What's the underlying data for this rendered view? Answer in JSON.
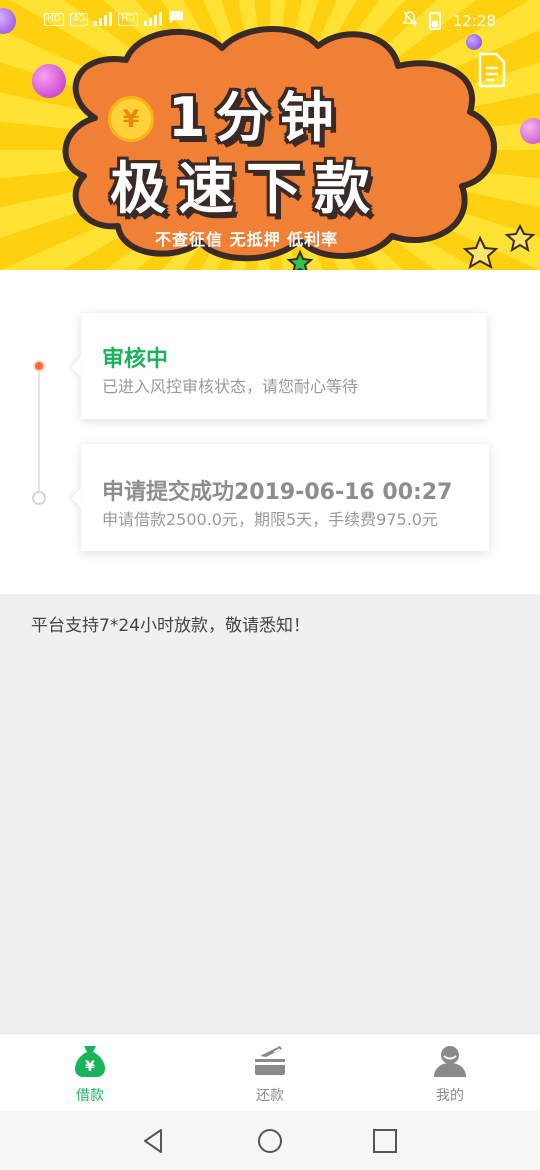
{
  "status_bar": {
    "left_badges": [
      "HD",
      "4G",
      "HD"
    ],
    "time": "12:28"
  },
  "banner": {
    "headline_line1": "1分钟",
    "headline_line2": "极速下款",
    "subline": "不查征信 无抵押 低利率",
    "coin_symbol": "¥",
    "colors": {
      "sunburst": "#ffd010",
      "cloud": "#f08036",
      "outline": "#3a2b28"
    }
  },
  "timeline": {
    "steps": [
      {
        "title": "审核中",
        "desc": "已进入风控审核状态，请您耐心等待",
        "state": "active"
      },
      {
        "title": "申请提交成功2019-06-16 00:27",
        "desc": "申请借款2500.0元，期限5天，手续费975.0元",
        "state": "done"
      }
    ],
    "colors": {
      "active_title": "#19b35c",
      "active_dot": "#fb6a35",
      "idle_title": "#8d8d8d"
    }
  },
  "notice": "平台支持7*24小时放款，敬请悉知！",
  "tabbar": {
    "tabs": [
      {
        "label": "借款",
        "icon": "money-bag-icon",
        "active": true
      },
      {
        "label": "还款",
        "icon": "repay-card-icon",
        "active": false
      },
      {
        "label": "我的",
        "icon": "user-profile-icon",
        "active": false
      }
    ],
    "colors": {
      "active": "#19b35c",
      "inactive": "#8a8a8a"
    }
  }
}
